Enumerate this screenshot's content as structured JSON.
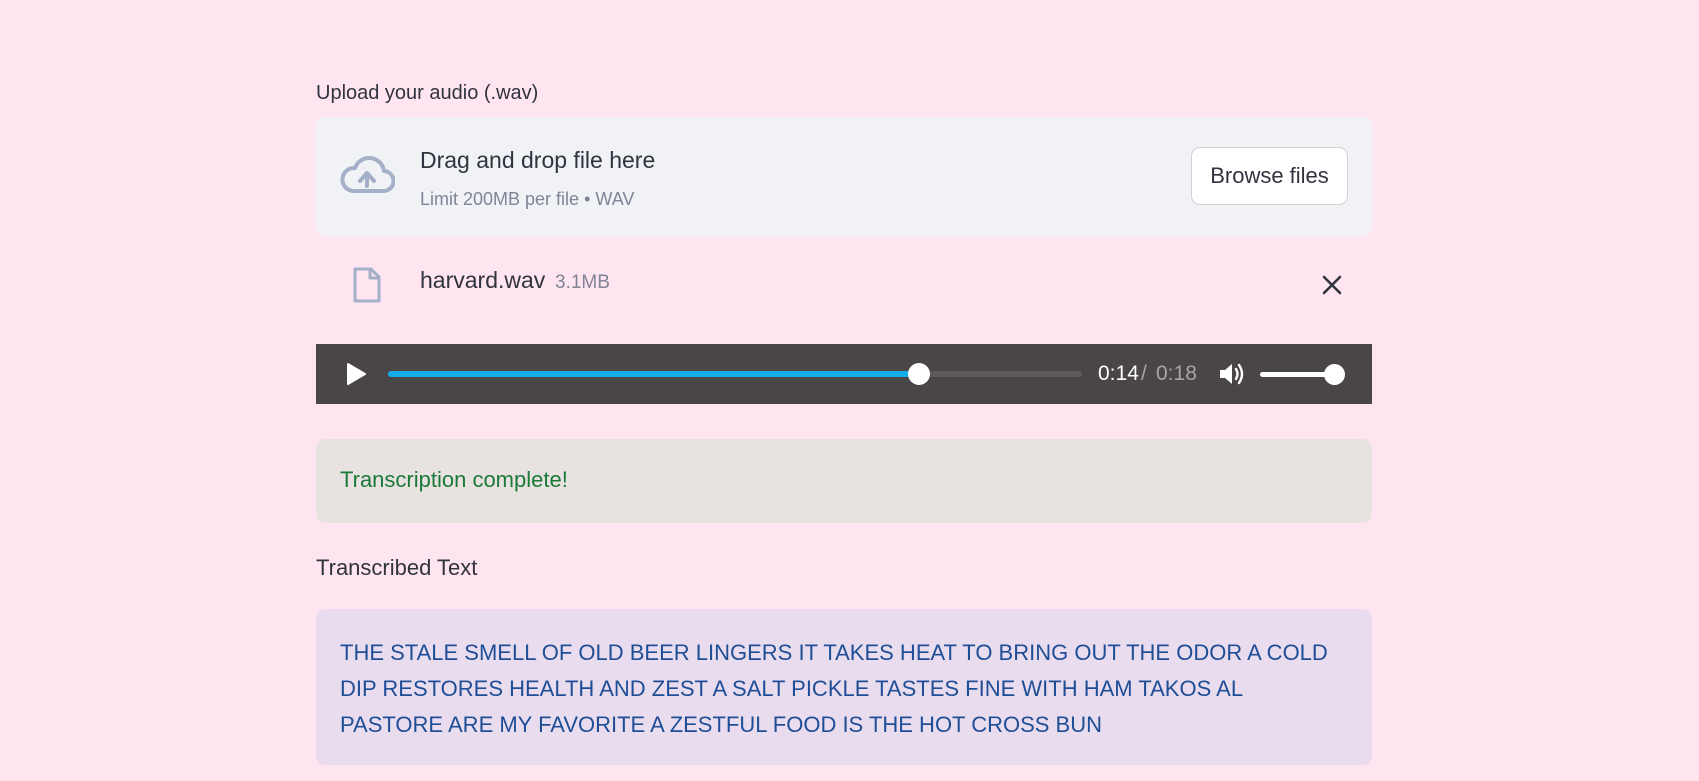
{
  "uploader": {
    "label": "Upload your audio (.wav)",
    "drop_title": "Drag and drop file here",
    "limit_text": "Limit 200MB per file • WAV",
    "browse_label": "Browse files",
    "icon": "cloud-upload-icon"
  },
  "file": {
    "name": "harvard.wav",
    "size": "3.1MB",
    "icon": "file-icon",
    "remove_icon": "close-icon"
  },
  "player": {
    "current_time": "0:14",
    "separator": "/",
    "duration": "0:18",
    "progress_fraction": 0.765,
    "volume_fraction": 0.88,
    "accent_color": "#13aee8"
  },
  "status": {
    "message": "Transcription complete!",
    "color": "#1b7a3a"
  },
  "transcription": {
    "heading": "Transcribed Text",
    "text": "THE STALE SMELL OF OLD BEER LINGERS IT TAKES HEAT TO BRING OUT THE ODOR A COLD DIP RESTORES HEALTH AND ZEST A SALT PICKLE TASTES FINE WITH HAM TAKOS AL PASTORE ARE MY FAVORITE A ZESTFUL FOOD IS THE HOT CROSS BUN"
  }
}
